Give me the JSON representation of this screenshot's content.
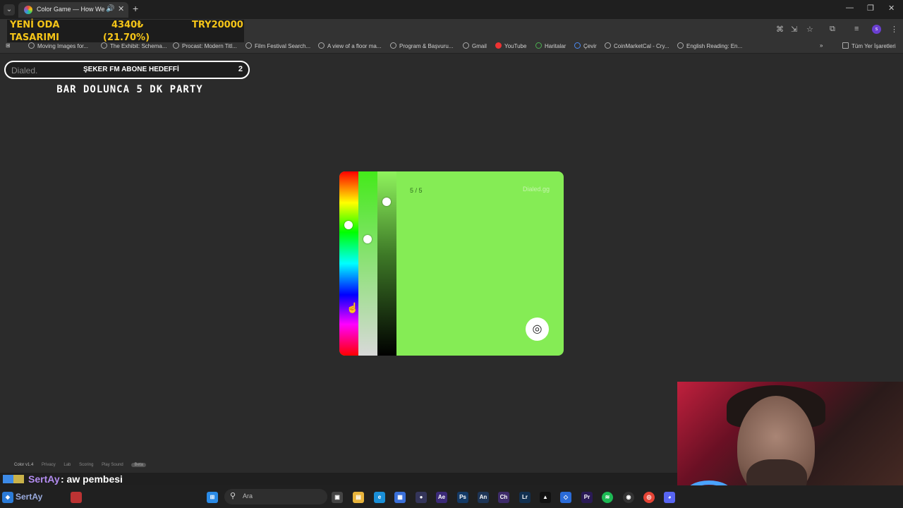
{
  "browser": {
    "tab_title": "Color Game — How Well C",
    "new_tab": "+",
    "bookmarks": [
      "Moving Images for...",
      "The Exhibit: Schema...",
      "Procast: Modern Titl...",
      "Film Festival Search...",
      "A view of a floor ma...",
      "Program & Başvuru...",
      "Gmail",
      "YouTube",
      "Haritalar",
      "Çevir",
      "CoinMarketCal - Cry...",
      "English Reading: En..."
    ],
    "all_bookmarks": "Tüm Yer İşaretleri",
    "profile_initial": "s"
  },
  "ticker": {
    "line1": "YENİ ODA",
    "line2": "TASARIMI",
    "amount": "4340₺",
    "percent": "(21.70%)",
    "goal": "TRY20000"
  },
  "sub_goal": {
    "brand": "Dialed.",
    "title": "ŞEKER FM ABONE HEDEFFİ",
    "count": "2",
    "subtitle": "BAR DOLUNCA 5 DK PARTY"
  },
  "game": {
    "round": "5 / 5",
    "brand": "Dialed.gg",
    "colors": {
      "target": "#85ec55"
    },
    "sliders": {
      "hue": 0.28,
      "saturation": 0.36,
      "lightness": 0.15
    },
    "submit_icon": "target-icon"
  },
  "footer": {
    "version": "Color v1.4",
    "links": [
      "Privacy",
      "Lab",
      "Scoring",
      "Play Sound"
    ],
    "badge": "Beta"
  },
  "chat": {
    "user": "SertAy",
    "message": ": aw pembesi"
  },
  "taskbar": {
    "search_placeholder": "Ara",
    "overlay_user": "SertAy"
  }
}
